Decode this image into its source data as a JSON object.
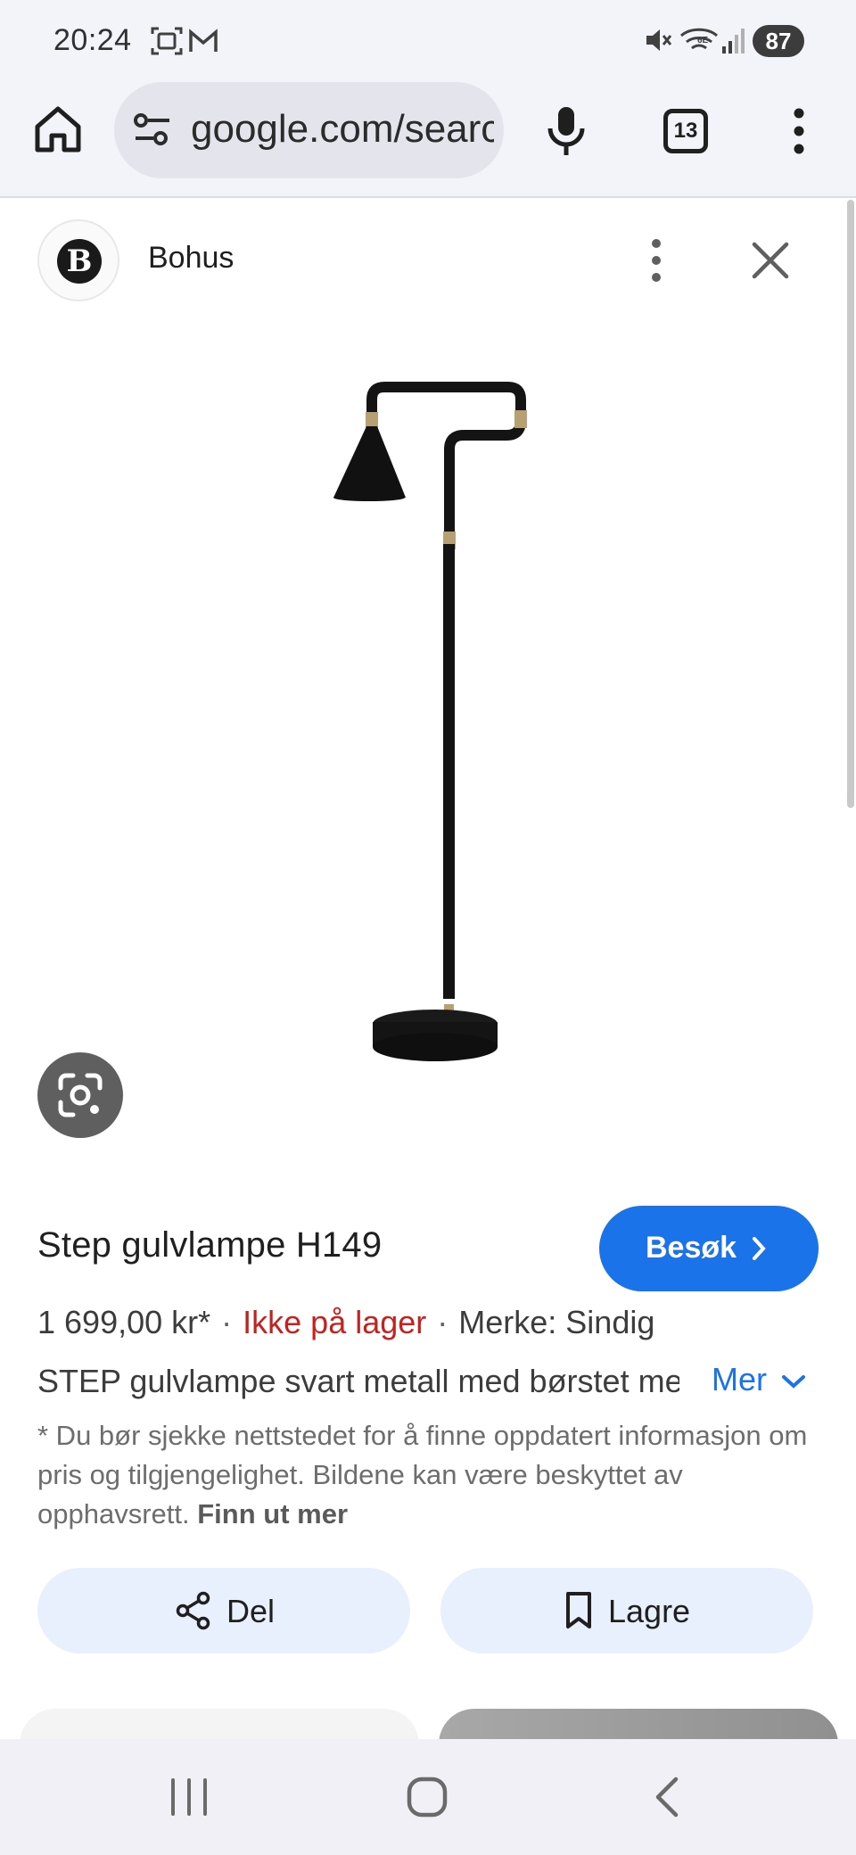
{
  "status_bar": {
    "time": "20:24",
    "battery": "87",
    "icons": [
      "screenshot-icon",
      "gmail-icon",
      "mute-icon",
      "wifi-6e-icon",
      "signal-icon"
    ]
  },
  "browser": {
    "url": "google.com/search",
    "tab_count": "13",
    "icons": [
      "home-icon",
      "site-settings-icon",
      "mic-icon",
      "tabs-icon",
      "more-vert-icon"
    ]
  },
  "sheet": {
    "site_initial": "B",
    "site_name": "Bohus"
  },
  "product": {
    "title": "Step gulvlampe H149",
    "visit_label": "Besøk",
    "price": "1 699,00 kr*",
    "separator": "·",
    "stock": "Ikke på lager",
    "brand": "Merke: Sindig",
    "description": "STEP gulvlampe svart metall med børstet messing detaljer",
    "more_label": "Mer",
    "disclaimer": "* Du bør sjekke nettstedet for å finne oppdatert informasjon om pris og tilgjengelighet. Bildene kan være beskyttet av opphavsrett.",
    "learn_more": "Finn ut mer"
  },
  "actions": {
    "share_label": "Del",
    "save_label": "Lagre"
  },
  "colors": {
    "accent": "#1a73e8",
    "out_of_stock": "#c5221f",
    "chip_bg": "#e8f0fe"
  }
}
